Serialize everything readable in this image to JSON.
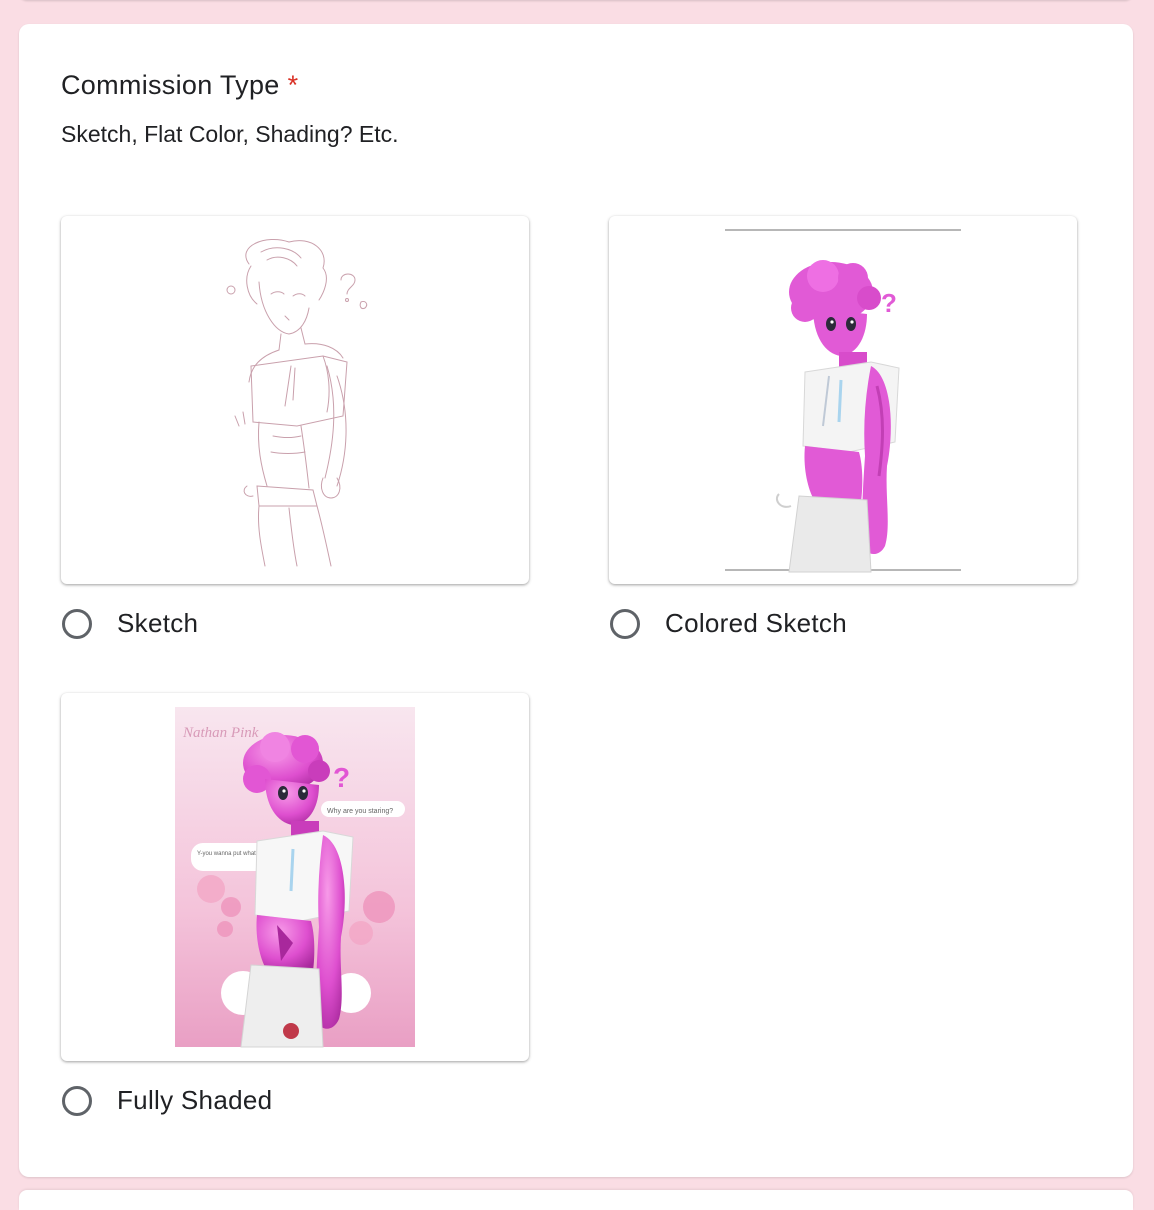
{
  "question": {
    "title": "Commission Type",
    "required_mark": "*",
    "description": "Sketch, Flat Color, Shading? Etc."
  },
  "options": [
    {
      "label": "Sketch",
      "selected": false,
      "image": "pencil-sketch-illustration"
    },
    {
      "label": "Colored Sketch",
      "selected": false,
      "image": "flat-color-illustration"
    },
    {
      "label": "Fully Shaded",
      "selected": false,
      "image": "fully-shaded-illustration"
    }
  ],
  "shaded_illustration": {
    "signature": "Nathan Pink",
    "bubble_right": "Why are you staring?",
    "bubble_left": "Y-you wanna put what in so?"
  },
  "colors": {
    "page_background": "#fadde4",
    "required_star": "#d93025",
    "radio_border": "#5f6368",
    "character_pink": "#e060d0"
  }
}
